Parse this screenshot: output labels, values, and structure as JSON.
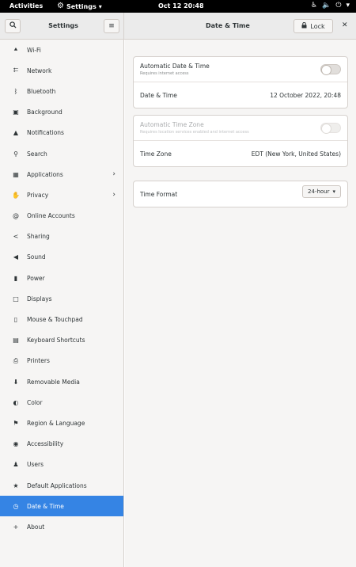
{
  "topbar": {
    "activities": "Activities",
    "app_menu": "Settings",
    "clock": "Oct 12  20:48"
  },
  "header": {
    "left_title": "Settings",
    "main_title": "Date & Time",
    "lock_label": "Lock"
  },
  "sidebar": {
    "items": [
      {
        "label": "Wi-Fi",
        "icon": "wifi-icon"
      },
      {
        "label": "Network",
        "icon": "network-icon"
      },
      {
        "label": "Bluetooth",
        "icon": "bluetooth-icon"
      },
      {
        "label": "Background",
        "icon": "background-icon"
      },
      {
        "label": "Notifications",
        "icon": "bell-icon"
      },
      {
        "label": "Search",
        "icon": "search-icon"
      },
      {
        "label": "Applications",
        "icon": "grid-icon",
        "has_submenu": true
      },
      {
        "label": "Privacy",
        "icon": "hand-icon",
        "has_submenu": true
      },
      {
        "label": "Online Accounts",
        "icon": "at-icon"
      },
      {
        "label": "Sharing",
        "icon": "share-icon"
      },
      {
        "label": "Sound",
        "icon": "speaker-icon"
      },
      {
        "label": "Power",
        "icon": "battery-icon"
      },
      {
        "label": "Displays",
        "icon": "monitor-icon"
      },
      {
        "label": "Mouse & Touchpad",
        "icon": "mouse-icon"
      },
      {
        "label": "Keyboard Shortcuts",
        "icon": "keyboard-icon"
      },
      {
        "label": "Printers",
        "icon": "printer-icon"
      },
      {
        "label": "Removable Media",
        "icon": "usb-icon"
      },
      {
        "label": "Color",
        "icon": "color-icon"
      },
      {
        "label": "Region & Language",
        "icon": "flag-icon"
      },
      {
        "label": "Accessibility",
        "icon": "accessibility-icon"
      },
      {
        "label": "Users",
        "icon": "users-icon"
      },
      {
        "label": "Default Applications",
        "icon": "star-icon"
      },
      {
        "label": "Date & Time",
        "icon": "clock-icon",
        "selected": true
      },
      {
        "label": "About",
        "icon": "about-icon"
      }
    ]
  },
  "main": {
    "auto_datetime": {
      "label": "Automatic Date & Time",
      "sub": "Requires internet access",
      "enabled": false
    },
    "datetime": {
      "label": "Date & Time",
      "value": "12 October 2022, 20:48"
    },
    "auto_timezone": {
      "label": "Automatic Time Zone",
      "sub": "Requires location services enabled and internet access",
      "enabled": false
    },
    "timezone": {
      "label": "Time Zone",
      "value": "EDT (New York, United States)"
    },
    "time_format": {
      "label": "Time Format",
      "value": "24-hour"
    }
  },
  "colors": {
    "accent": "#3584e4",
    "topbar": "#000000",
    "sidebar_bg": "#f6f5f4"
  }
}
